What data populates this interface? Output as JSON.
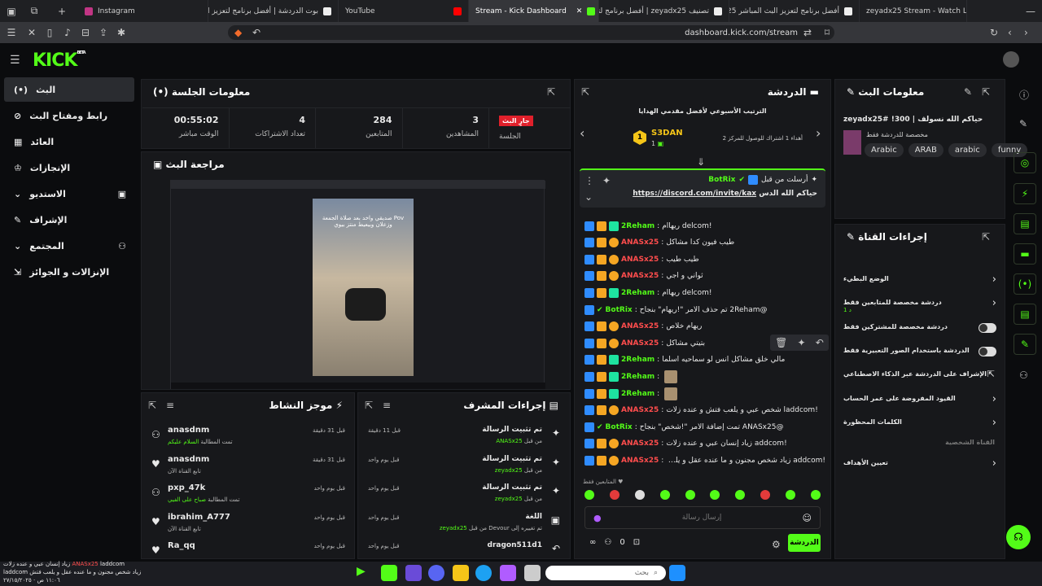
{
  "browser": {
    "tabs": [
      "Instagram",
      "بوت الدردشة | أفضل برنامج لتعزيز البث",
      "YouTube",
      "Stream - Kick Dashboard",
      "تصنيف zeyadx25 | أفضل برنامج لتعزيز",
      "أفضل برنامج لتعزيز البث المباشر zeyadx25",
      "zeyadx25 Stream - Watch Live on Ki"
    ],
    "url": "dashboard.kick.com/stream"
  },
  "app": {
    "logo": "KICK",
    "beta": "BETA"
  },
  "sidebar": {
    "items": [
      "البث",
      "رابط ومفتاح البث",
      "العائد",
      "الإنجازات",
      "الاستديو",
      "الإشراف",
      "المجتمع",
      "الإنزالات و الجوائز"
    ]
  },
  "session": {
    "title": "معلومات الجلسة",
    "live_badge": "جارٍ البث",
    "session_label": "الجلسة",
    "stats": [
      {
        "value": "00:55:02",
        "label": "الوقت مباشر"
      },
      {
        "value": "4",
        "label": "تعداد الاشتراكات"
      },
      {
        "value": "284",
        "label": "المتابعين"
      },
      {
        "value": "3",
        "label": "المشاهدين"
      }
    ]
  },
  "preview": {
    "title": "مراجعة البث",
    "overlay_text": "Pov صديقي واخد بعد صلاة الجمعة وزعلان وبيعيط منتز بيوي"
  },
  "activity": {
    "title": "موجز النشاط",
    "items": [
      {
        "user": "anasdnm",
        "desc": "تمت المطالبة",
        "reward": "السلام عليكم",
        "time": "قبل 31 دقيقة"
      },
      {
        "user": "anasdnm",
        "desc": "تابع القناة الآن",
        "reward": "",
        "time": "قبل 31 دقيقة"
      },
      {
        "user": "pxp_47k",
        "desc": "تمت المطالبة",
        "reward": "صباح على الفيي",
        "time": "قبل يوم واحد"
      },
      {
        "user": "ibrahim_A777",
        "desc": "تابع القناة الآن",
        "reward": "",
        "time": "قبل يوم واحد"
      },
      {
        "user": "Ra_qq",
        "desc": "",
        "reward": "",
        "time": "قبل يوم واحد"
      }
    ]
  },
  "modactions": {
    "title": "إجراءات المشرف",
    "items": [
      {
        "title": "تم تثبيت الرسالة",
        "by": "ANASx25",
        "prefix": "من قبل",
        "time": "قبل 11 دقيقة"
      },
      {
        "title": "تم تثبيت الرسالة",
        "by": "zeyadx25",
        "prefix": "من قبل",
        "time": "قبل يوم واحد"
      },
      {
        "title": "تم تثبيت الرسالة",
        "by": "zeyadx25",
        "prefix": "من قبل",
        "time": "قبل يوم واحد"
      },
      {
        "title": "اللغة",
        "by": "zeyadx25",
        "prefix": "تم تغييره إلى Devour من قبل",
        "time": "قبل يوم واحد"
      },
      {
        "title": "dragon511d1",
        "by": "",
        "prefix": "",
        "time": "قبل يوم واحد"
      }
    ]
  },
  "chat": {
    "title": "الدردشة",
    "leaderboard_title": "الترتيب الأسبوعي لأفضل مقدمي الهدايا",
    "leader_name": "S3DAN",
    "leader_rank": "1",
    "leader_count": "1",
    "leader_note": "أهداء 1 اشتراك للوصول للمركز 2",
    "pinned_by": "أرسلت من قبل",
    "pinned_user": "BotRix",
    "pinned_text": "حياكم الله الدس",
    "pinned_link": "https://discord.com/invite/kax",
    "messages": [
      {
        "user": "2Reham",
        "ucolor": "#53fc18",
        "text": "!delcom ريهاام"
      },
      {
        "user": "ANASx25",
        "ucolor": "#ff4d4d",
        "text": "طيب فيون كدا مشاكل"
      },
      {
        "user": "ANASx25",
        "ucolor": "#ff4d4d",
        "text": "طيب طيب"
      },
      {
        "user": "ANASx25",
        "ucolor": "#ff4d4d",
        "text": "ثواني و اجي"
      },
      {
        "user": "2Reham",
        "ucolor": "#53fc18",
        "text": "!delcom ريهاام"
      },
      {
        "user": "BotRix",
        "ucolor": "#53fc18",
        "text": "@2Reham تم حذف الأمر \"!ريهام\" بنجاح"
      },
      {
        "user": "ANASx25",
        "ucolor": "#ff4d4d",
        "text": "ريهام خلاص"
      },
      {
        "user": "ANASx25",
        "ucolor": "#ff4d4d",
        "text": "بتيتي مشاكل"
      },
      {
        "user": "2Reham",
        "ucolor": "#53fc18",
        "text": "مالي خلق مشاكل انس لو سماحيه اسلما"
      },
      {
        "user": "2Reham",
        "ucolor": "#53fc18",
        "text": ""
      },
      {
        "user": "2Reham",
        "ucolor": "#53fc18",
        "text": ""
      },
      {
        "user": "ANASx25",
        "ucolor": "#ff4d4d",
        "text": "!laddcom شخص عبي و يلعب فتش و عنده زلات"
      },
      {
        "user": "BotRix",
        "ucolor": "#53fc18",
        "text": "@ANASx25 تمت إضافة الأمر \"!شخص\" بنجاح"
      },
      {
        "user": "ANASx25",
        "ucolor": "#ff4d4d",
        "text": "!addcom زياد إنسان عبي و عنده زلات"
      },
      {
        "user": "ANASx25",
        "ucolor": "#ff4d4d",
        "text": "!addcom زياد شخص مجنون و ما عنده عقل و يلعب فتش"
      }
    ],
    "followers_only": "المتابعين فقط",
    "input_placeholder": "إرسال رسالة",
    "send_label": "الدردشة",
    "count": "0"
  },
  "streaminfo": {
    "title": "معلومات البث",
    "stream_title": "حياكم الله نسولف | 300! zeyadx25#",
    "category": "مخصصة للدردشة فقط",
    "tags": [
      "Arabic",
      "ARAB",
      "arabic",
      "funny"
    ]
  },
  "channelactions": {
    "title": "إجراءات القناة",
    "items": [
      "الوضع البطيء",
      "دردشة مخصصة للمتابعين فقط",
      "دردشة مخصصة للمشتركين فقط",
      "الدردشة باستخدام الصور التعبيرية فقط",
      "الإشراف على الدردشة عبر الذكاء الاصطناعي",
      "القيود المفروضة على عمر الحساب",
      "الكلمات المحظورة",
      "القناة الشخصية",
      "تعيين الأهداف"
    ],
    "sub_label": "1 د"
  },
  "taskbar": {
    "search_placeholder": "بحث",
    "time": "١١:٠٦ ص",
    "date": "٢٧/١٥/٢٠٢٥",
    "ticker1": "laddcom زياد إنسان عبي و عنده زلات",
    "ticker2": "زياد شخص مجنون و ما عنده عقل و يلعب فتش laddcom",
    "ticker_user": "ANASx25"
  }
}
